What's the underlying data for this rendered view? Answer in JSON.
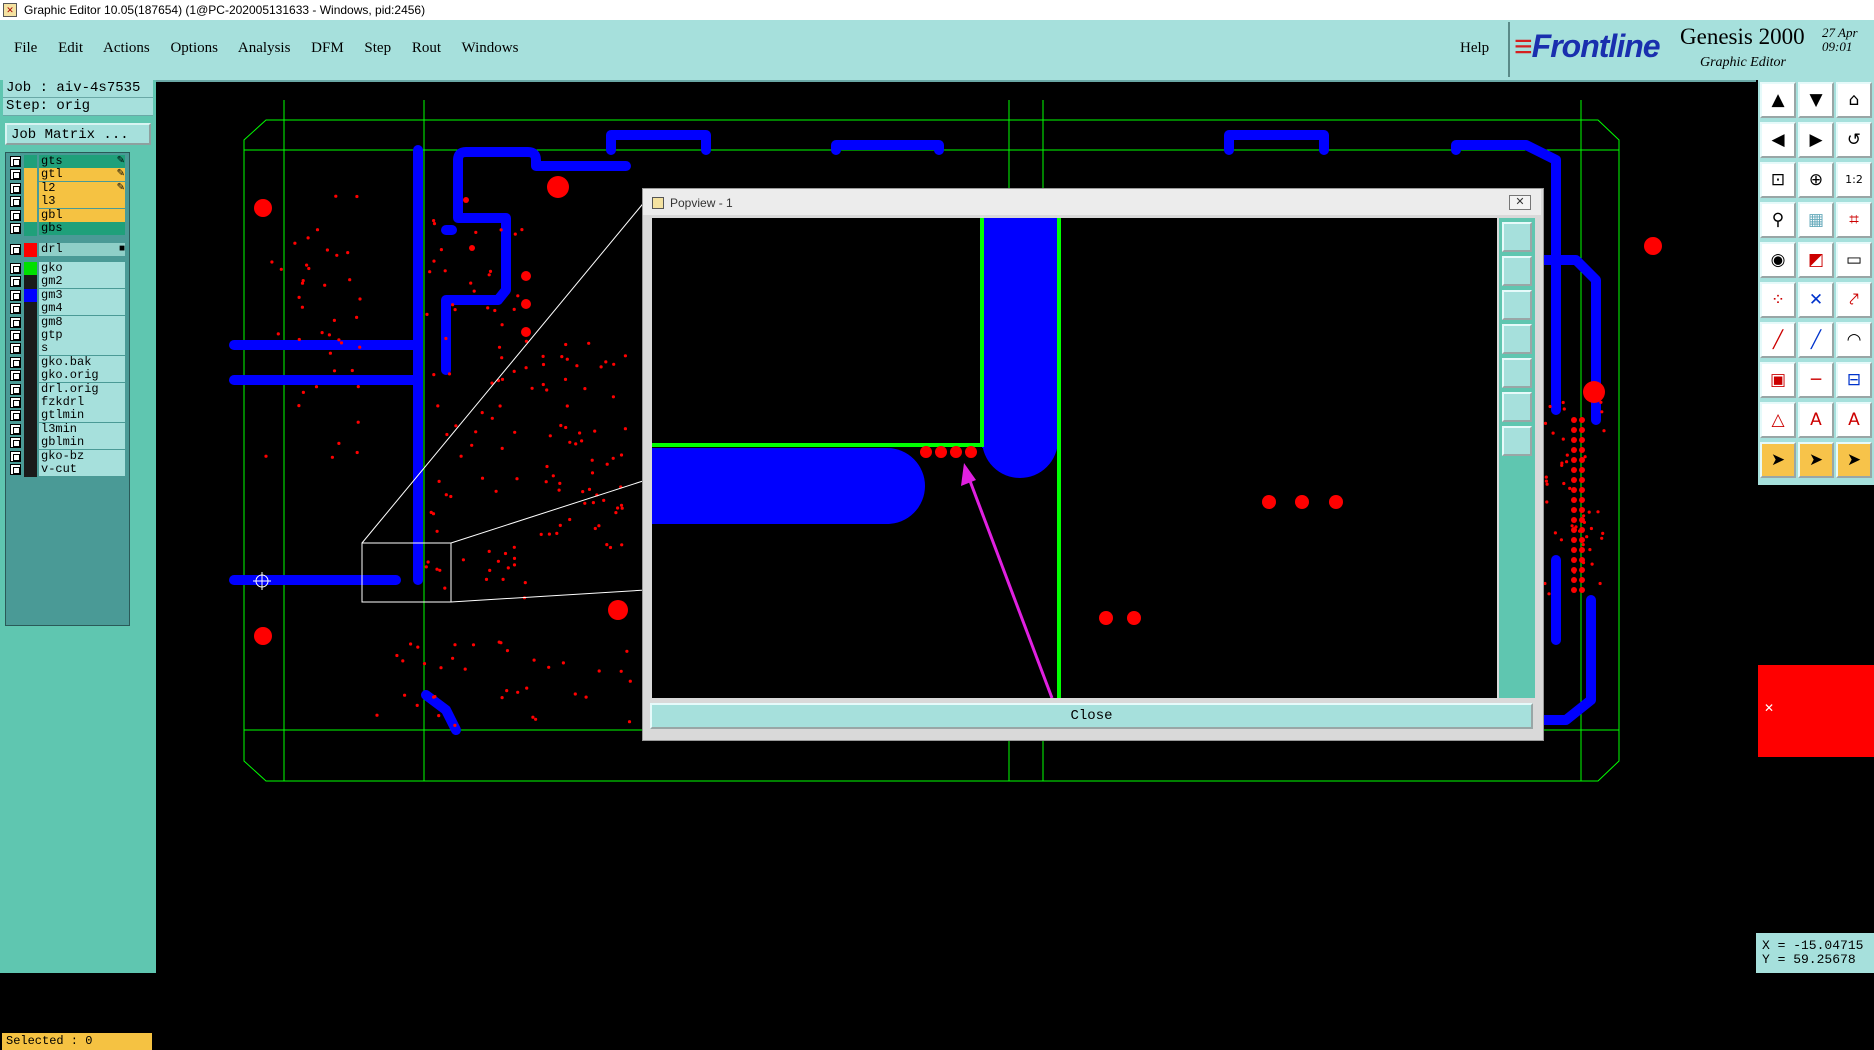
{
  "title_bar": {
    "icon": "x-window-icon",
    "text": "Graphic Editor 10.05(187654) (1@PC-202005131633 - Windows, pid:2456)"
  },
  "menu": {
    "items": [
      "File",
      "Edit",
      "Actions",
      "Options",
      "Analysis",
      "DFM",
      "Step",
      "Rout",
      "Windows"
    ],
    "help": "Help"
  },
  "logo": {
    "brand": "Frontline",
    "product": "Genesis 2000",
    "subtitle": "Graphic Editor",
    "date": "27 Apr",
    "time": "09:01"
  },
  "job": {
    "job_label": "Job : aiv-4s7535",
    "step_label": "Step: orig",
    "matrix_button": "Job Matrix ..."
  },
  "layers": [
    {
      "name": "gts",
      "color": "#1fa07a",
      "bg": "#1fa07a",
      "flag": "✎"
    },
    {
      "name": "gtl",
      "color": "#f5c242",
      "bg": "#f5c242",
      "flag": "✎"
    },
    {
      "name": "l2",
      "color": "#f5c242",
      "bg": "#f5c242",
      "flag": "✎"
    },
    {
      "name": "l3",
      "color": "#f5c242",
      "bg": "#f5c242",
      "flag": ""
    },
    {
      "name": "gbl",
      "color": "#f5c242",
      "bg": "#f5c242",
      "flag": ""
    },
    {
      "name": "gbs",
      "color": "#1fa07a",
      "bg": "#1fa07a",
      "flag": ""
    },
    {
      "name": "drl",
      "color": "#ff0000",
      "bg": "#8fcfc8",
      "flag": "■"
    },
    {
      "name": "gko",
      "color": "#00e000",
      "bg": "#a6e0dc",
      "flag": ""
    },
    {
      "name": "gm2",
      "color": "#1a1a1a",
      "bg": "#a6e0dc",
      "flag": ""
    },
    {
      "name": "gm3",
      "color": "#0000ff",
      "bg": "#a6e0dc",
      "flag": ""
    },
    {
      "name": "gm4",
      "color": "#1a1a1a",
      "bg": "#a6e0dc",
      "flag": ""
    },
    {
      "name": "gm8",
      "color": "#1a1a1a",
      "bg": "#a6e0dc",
      "flag": ""
    },
    {
      "name": "gtp",
      "color": "#1a1a1a",
      "bg": "#a6e0dc",
      "flag": ""
    },
    {
      "name": "s",
      "color": "#1a1a1a",
      "bg": "#a6e0dc",
      "flag": ""
    },
    {
      "name": "gko.bak",
      "color": "#1a1a1a",
      "bg": "#a6e0dc",
      "flag": ""
    },
    {
      "name": "gko.orig",
      "color": "#1a1a1a",
      "bg": "#a6e0dc",
      "flag": ""
    },
    {
      "name": "drl.orig",
      "color": "#1a1a1a",
      "bg": "#a6e0dc",
      "flag": ""
    },
    {
      "name": "fzkdrl",
      "color": "#1a1a1a",
      "bg": "#a6e0dc",
      "flag": ""
    },
    {
      "name": "gtlmin",
      "color": "#1a1a1a",
      "bg": "#a6e0dc",
      "flag": ""
    },
    {
      "name": "l3min",
      "color": "#1a1a1a",
      "bg": "#a6e0dc",
      "flag": ""
    },
    {
      "name": "gblmin",
      "color": "#1a1a1a",
      "bg": "#a6e0dc",
      "flag": ""
    },
    {
      "name": "gko-bz",
      "color": "#1a1a1a",
      "bg": "#a6e0dc",
      "flag": ""
    },
    {
      "name": "v-cut",
      "color": "#1a1a1a",
      "bg": "#a6e0dc",
      "flag": ""
    }
  ],
  "status": {
    "selected": "Selected : 0"
  },
  "coords": {
    "x": "X = -15.04715",
    "y": "Y = 59.25678"
  },
  "popup": {
    "title": "Popview - 1",
    "close_label": "Close"
  },
  "colors": {
    "board_outline": "#00ff00",
    "copper": "#0000ff",
    "drill": "#ff0000",
    "panel": "#a6e0dc",
    "arrow": "#e020e0"
  }
}
